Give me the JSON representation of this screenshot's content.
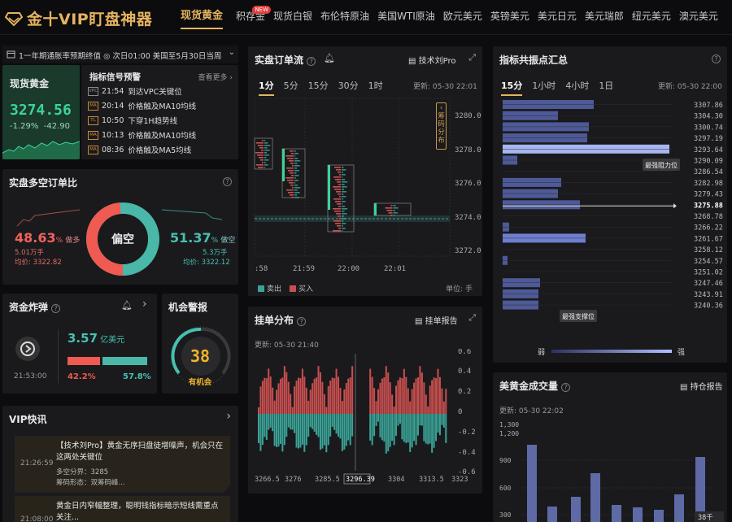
{
  "app_title": "金十VIP盯盘神器",
  "nav": {
    "tabs": [
      {
        "label": "现货黄金",
        "badge": ""
      },
      {
        "label": "积存金",
        "badge": "NEW"
      },
      {
        "label": "现货白银",
        "badge": ""
      },
      {
        "label": "布伦特原油",
        "badge": ""
      },
      {
        "label": "美国WTI原油",
        "badge": ""
      },
      {
        "label": "欧元美元",
        "badge": ""
      },
      {
        "label": "英镑美元",
        "badge": ""
      },
      {
        "label": "美元日元",
        "badge": ""
      },
      {
        "label": "美元瑞郎",
        "badge": ""
      },
      {
        "label": "纽元美元",
        "badge": ""
      },
      {
        "label": "澳元美元",
        "badge": ""
      }
    ]
  },
  "event_bar": {
    "text": "1一年期通胀率预期终值 ◎ 次日01:00 美国至5月30日当周石"
  },
  "quote": {
    "name": "现货黄金",
    "price": "3274.56",
    "change_pct": "-1.29%",
    "change_abs": "-42.90"
  },
  "signals": {
    "title": "指标信号预警",
    "more": "查看更多",
    "items": [
      {
        "badge": "VPC",
        "time": "21:54",
        "text": "到达VPC关键位"
      },
      {
        "badge": "MA",
        "time": "20:14",
        "text": "价格触及MA10均线"
      },
      {
        "badge": "TL",
        "time": "10:50",
        "text": "下穿1H趋势线"
      },
      {
        "badge": "MA",
        "time": "10:13",
        "text": "价格触及MA10均线"
      },
      {
        "badge": "MA",
        "time": "08:36",
        "text": "价格触及MA5均线"
      }
    ]
  },
  "longshort": {
    "title": "实盘多空订单比",
    "left_pct": "48.63",
    "left_label": "做多",
    "left_vol": "5.01万手",
    "left_avg_label": "均价:",
    "left_avg": "3322.82",
    "right_pct": "51.37",
    "right_label": "做空",
    "right_vol": "5.3万手",
    "right_avg_label": "均价:",
    "right_avg": "3322.12",
    "center": "偏空",
    "pct_sign": "%",
    "ratio": 0.4863
  },
  "bomb": {
    "title": "资金炸弹",
    "time": "21:53:00",
    "amount": "3.57",
    "unit": "亿美元",
    "red_pct": "42.2%",
    "green_pct": "57.8%",
    "ratio": 0.422
  },
  "alert": {
    "title": "机会警报",
    "value": "38",
    "label": "有机会"
  },
  "vip": {
    "title": "VIP快讯",
    "items": [
      {
        "time": "21:26:59",
        "title": "【技术刘Pro】黄金无序扫盘徒增噪声，机会只在这两处关键位",
        "line1": "多空分界：3285",
        "line2": "筹码形态：双筹码峰..."
      },
      {
        "time": "21:08:00",
        "title": "黄金日内窄幅整理，聪明钱指标暗示短线需重点关注...",
        "line1": "",
        "line2": ""
      }
    ]
  },
  "orderflow": {
    "title": "实盘订单流",
    "tool": "技术刘Pro",
    "tabs": [
      "1分",
      "5分",
      "15分",
      "30分",
      "1时"
    ],
    "updated": "更新: 05-30 22:01",
    "side_tab": "筹码分布",
    "yticks": [
      "3280.0",
      "3278.0",
      "3276.0",
      "3274.0",
      "3272.0"
    ],
    "xticks": [
      ":58",
      "21:59",
      "22:00",
      "22:01"
    ],
    "legend_sell": "卖出",
    "legend_buy": "买入",
    "unit": "单位: 手"
  },
  "pending": {
    "title": "挂单分布",
    "report": "挂单报告",
    "updated": "更新: 05-30 21:40",
    "yticks": [
      "0.6",
      "0.4",
      "0.2",
      "0",
      "-0.2",
      "-0.4",
      "-0.6"
    ],
    "xticks": [
      "3266.5",
      "3276",
      "3285.5",
      "3296.39",
      "3304",
      "3313.5",
      "3323"
    ]
  },
  "resonance": {
    "title": "指标共振点汇总",
    "tabs": [
      "15分",
      "1小时",
      "4小时",
      "1日"
    ],
    "updated": "更新: 05-30 22:00",
    "levels": [
      "3307.86",
      "3304.30",
      "3300.74",
      "3297.19",
      "3293.64",
      "3290.09",
      "3286.54",
      "3282.98",
      "3279.43",
      "3275.88",
      "3268.78",
      "3266.22",
      "3261.67",
      "3258.12",
      "3254.57",
      "3251.02",
      "3247.46",
      "3243.91",
      "3240.36"
    ],
    "current": "3275.88",
    "tip_res": "最强阻力位",
    "tip_sup": "最强支撑位",
    "weak": "弱",
    "strong": "强"
  },
  "volume": {
    "title": "美黄金成交量",
    "report": "持仓报告",
    "updated": "更新: 05-30 22:02",
    "yticks": [
      "1,300",
      "1,200",
      "900",
      "600",
      "300"
    ],
    "unit": "38千"
  }
}
